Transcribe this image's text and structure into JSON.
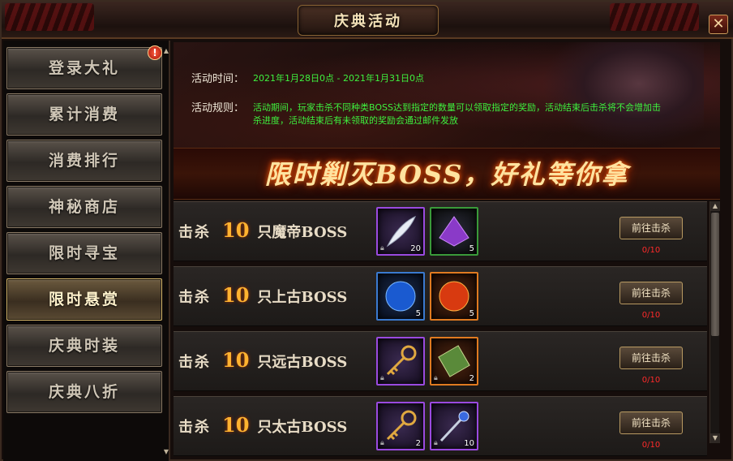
{
  "window": {
    "title": "庆典活动",
    "close_label": "✕"
  },
  "sidebar": {
    "alert": "!",
    "items": [
      {
        "label": "登录大礼",
        "active": false
      },
      {
        "label": "累计消费",
        "active": false
      },
      {
        "label": "消费排行",
        "active": false
      },
      {
        "label": "神秘商店",
        "active": false
      },
      {
        "label": "限时寻宝",
        "active": false
      },
      {
        "label": "限时悬赏",
        "active": true
      },
      {
        "label": "庆典时装",
        "active": false
      },
      {
        "label": "庆典八折",
        "active": false
      }
    ]
  },
  "info": {
    "time_label": "活动时间：",
    "time_value": "2021年1月28日0点 - 2021年1月31日0点",
    "rules_label": "活动规则：",
    "rules_line1": "活动期间，玩家击杀不同种类BOSS达到指定的数量可以领取指定的奖励，活动结束后击杀将不会增加击",
    "rules_line2": "杀进度，活动结束后有未领取的奖励会通过邮件发放"
  },
  "slogan": "限时剿灭BOSS，好礼等你拿",
  "rows": [
    {
      "kill_label": "击杀",
      "count": "10",
      "boss": "只魔帝BOSS",
      "items": [
        {
          "icon": "feather-icon",
          "qty": "20",
          "rarity": "purple"
        },
        {
          "icon": "crystal-icon",
          "qty": "5",
          "rarity": "green"
        }
      ],
      "button": "前往击杀",
      "progress": "0/10"
    },
    {
      "kill_label": "击杀",
      "count": "10",
      "boss": "只上古BOSS",
      "items": [
        {
          "icon": "blue-orb-icon",
          "qty": "5",
          "rarity": "blue"
        },
        {
          "icon": "fire-orb-icon",
          "qty": "5",
          "rarity": "orange"
        }
      ],
      "button": "前往击杀",
      "progress": "0/10"
    },
    {
      "kill_label": "击杀",
      "count": "10",
      "boss": "只远古BOSS",
      "items": [
        {
          "icon": "key-icon",
          "qty": "",
          "rarity": "purple"
        },
        {
          "icon": "scroll-icon",
          "qty": "2",
          "rarity": "orange"
        }
      ],
      "button": "前往击杀",
      "progress": "0/10"
    },
    {
      "kill_label": "击杀",
      "count": "10",
      "boss": "只太古BOSS",
      "items": [
        {
          "icon": "key-icon",
          "qty": "2",
          "rarity": "purple"
        },
        {
          "icon": "staff-icon",
          "qty": "10",
          "rarity": "purple"
        }
      ],
      "button": "前往击杀",
      "progress": "0/10"
    }
  ],
  "colors": {
    "accent": "#ffb230",
    "info_value": "#3ef03e",
    "progress": "#ff2a2a"
  }
}
